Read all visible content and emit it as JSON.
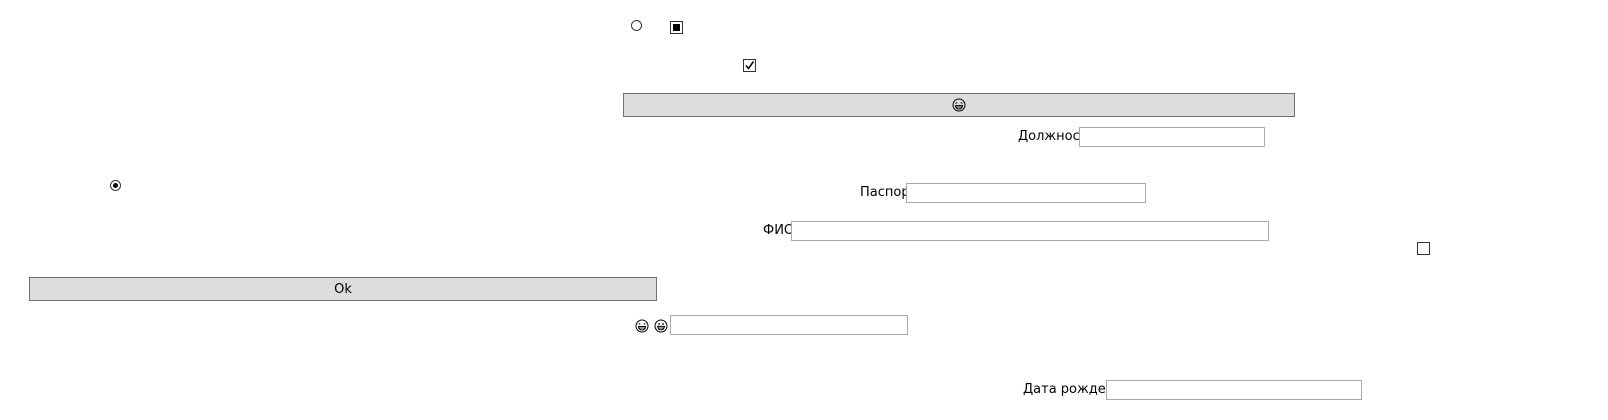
{
  "top_controls": {
    "radio_unchecked": {
      "checked": false
    },
    "checkbox_indeterminate": {
      "state": "indeterminate"
    },
    "checkbox_checked": {
      "checked": true
    }
  },
  "emoji_button": {
    "icon": "laughing-face-icon"
  },
  "fields": {
    "position_label": "Должность",
    "position_value": "",
    "passport_label": "Паспорт",
    "passport_value": "",
    "fio_label": "ФИО",
    "fio_value": "",
    "emoji_field_value": "",
    "birthdate_label": "Дата рождения",
    "birthdate_value": ""
  },
  "left_radio": {
    "checked": true
  },
  "right_checkbox": {
    "checked": false
  },
  "ok_button": {
    "label": "Ok"
  },
  "emoji_row": {
    "icons": [
      "laughing-face-icon",
      "grinning-face-icon"
    ]
  }
}
